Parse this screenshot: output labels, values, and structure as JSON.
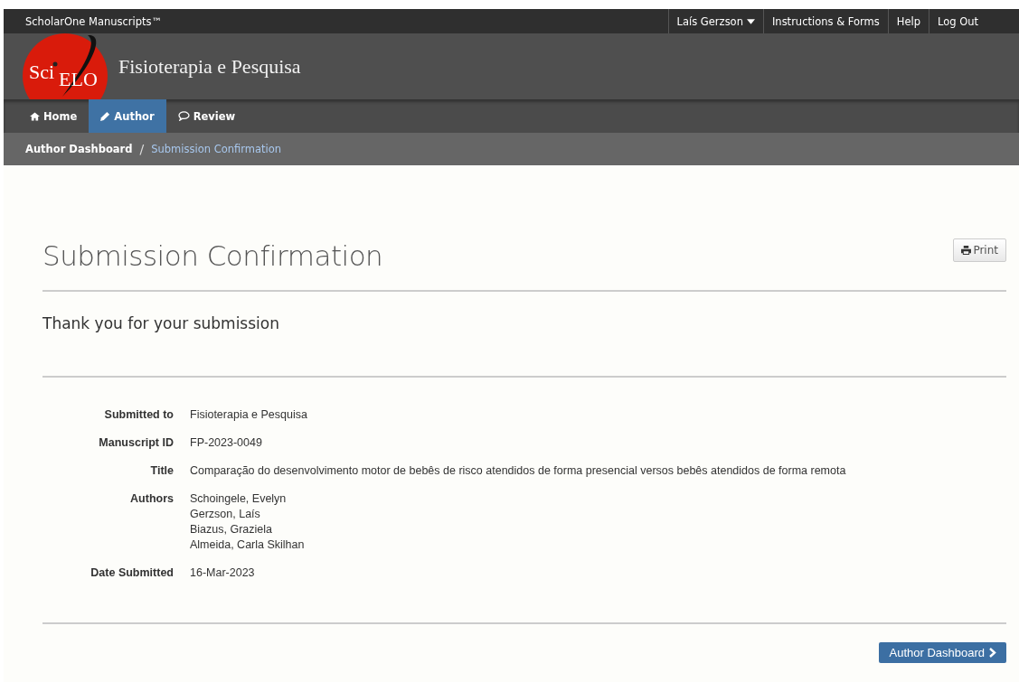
{
  "top_bar": {
    "brand": "ScholarOne Manuscripts™",
    "links": [
      {
        "label": "Laís Gerzson",
        "kind": "dropdown"
      },
      {
        "label": "Instructions & Forms",
        "kind": "link"
      },
      {
        "label": "Help",
        "kind": "link"
      },
      {
        "label": "Log Out",
        "kind": "link"
      }
    ]
  },
  "header": {
    "logo": {
      "part_1": "Sci",
      "part_2": "ELO"
    },
    "journal": "Fisioterapia e Pesquisa"
  },
  "nav": [
    {
      "label": "Home",
      "kind": "home",
      "selected": false
    },
    {
      "label": "Author",
      "kind": "pencil",
      "selected": true
    },
    {
      "label": "Review",
      "kind": "comment",
      "selected": false
    }
  ],
  "breadcrumb": [
    {
      "label": "Author Dashboard",
      "current": false
    },
    {
      "label": "Submission Confirmation",
      "current": true
    }
  ],
  "breadcrumb_separator": "/",
  "page_title": "Submission Confirmation",
  "print_button": "Print",
  "subtitle": "Thank you for your submission",
  "details": [
    {
      "label": "Submitted to",
      "values": [
        "Fisioterapia e Pesquisa"
      ]
    },
    {
      "label": "Manuscript ID",
      "values": [
        "FP-2023-0049"
      ]
    },
    {
      "label": "Title",
      "values": [
        "Comparação do desenvolvimento motor de bebês de risco atendidos de forma presencial versos bebês atendidos de forma remota"
      ]
    },
    {
      "label": "Authors",
      "values": [
        "Schoingele, Evelyn",
        "Gerzson, Laís",
        "Biazus, Graziela",
        "Almeida, Carla Skilhan"
      ]
    },
    {
      "label": "Date Submitted",
      "values": [
        "16-Mar-2023"
      ]
    }
  ],
  "dashboard_button": "Author Dashboard"
}
